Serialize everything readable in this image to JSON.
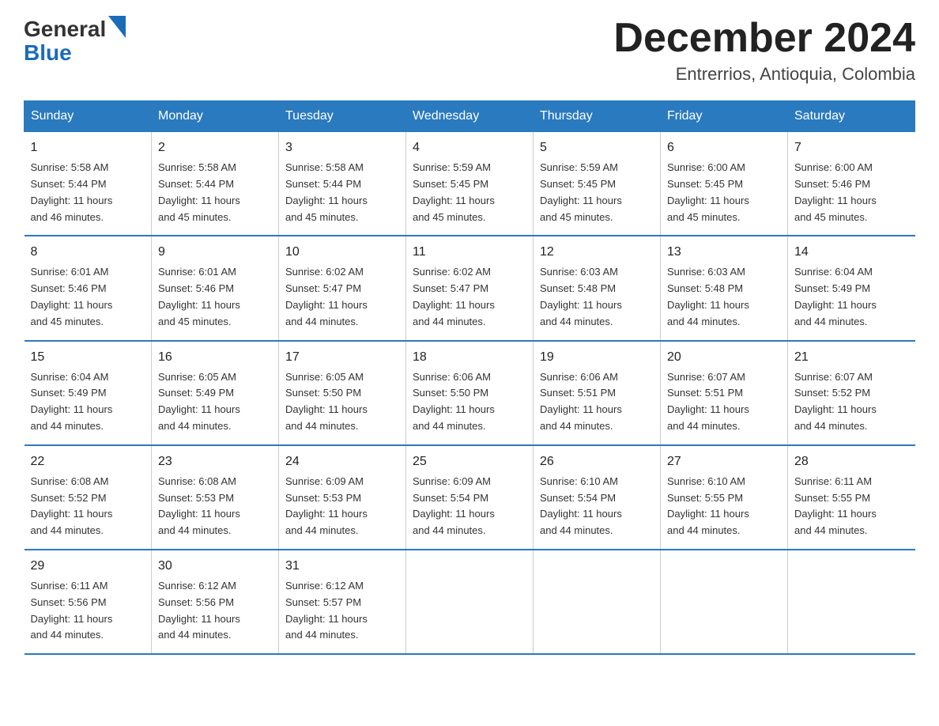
{
  "logo": {
    "general": "General",
    "blue": "Blue"
  },
  "header": {
    "month": "December 2024",
    "location": "Entrerrios, Antioquia, Colombia"
  },
  "weekdays": [
    "Sunday",
    "Monday",
    "Tuesday",
    "Wednesday",
    "Thursday",
    "Friday",
    "Saturday"
  ],
  "weeks": [
    [
      {
        "day": "1",
        "sunrise": "5:58 AM",
        "sunset": "5:44 PM",
        "daylight": "11 hours and 46 minutes."
      },
      {
        "day": "2",
        "sunrise": "5:58 AM",
        "sunset": "5:44 PM",
        "daylight": "11 hours and 45 minutes."
      },
      {
        "day": "3",
        "sunrise": "5:58 AM",
        "sunset": "5:44 PM",
        "daylight": "11 hours and 45 minutes."
      },
      {
        "day": "4",
        "sunrise": "5:59 AM",
        "sunset": "5:45 PM",
        "daylight": "11 hours and 45 minutes."
      },
      {
        "day": "5",
        "sunrise": "5:59 AM",
        "sunset": "5:45 PM",
        "daylight": "11 hours and 45 minutes."
      },
      {
        "day": "6",
        "sunrise": "6:00 AM",
        "sunset": "5:45 PM",
        "daylight": "11 hours and 45 minutes."
      },
      {
        "day": "7",
        "sunrise": "6:00 AM",
        "sunset": "5:46 PM",
        "daylight": "11 hours and 45 minutes."
      }
    ],
    [
      {
        "day": "8",
        "sunrise": "6:01 AM",
        "sunset": "5:46 PM",
        "daylight": "11 hours and 45 minutes."
      },
      {
        "day": "9",
        "sunrise": "6:01 AM",
        "sunset": "5:46 PM",
        "daylight": "11 hours and 45 minutes."
      },
      {
        "day": "10",
        "sunrise": "6:02 AM",
        "sunset": "5:47 PM",
        "daylight": "11 hours and 44 minutes."
      },
      {
        "day": "11",
        "sunrise": "6:02 AM",
        "sunset": "5:47 PM",
        "daylight": "11 hours and 44 minutes."
      },
      {
        "day": "12",
        "sunrise": "6:03 AM",
        "sunset": "5:48 PM",
        "daylight": "11 hours and 44 minutes."
      },
      {
        "day": "13",
        "sunrise": "6:03 AM",
        "sunset": "5:48 PM",
        "daylight": "11 hours and 44 minutes."
      },
      {
        "day": "14",
        "sunrise": "6:04 AM",
        "sunset": "5:49 PM",
        "daylight": "11 hours and 44 minutes."
      }
    ],
    [
      {
        "day": "15",
        "sunrise": "6:04 AM",
        "sunset": "5:49 PM",
        "daylight": "11 hours and 44 minutes."
      },
      {
        "day": "16",
        "sunrise": "6:05 AM",
        "sunset": "5:49 PM",
        "daylight": "11 hours and 44 minutes."
      },
      {
        "day": "17",
        "sunrise": "6:05 AM",
        "sunset": "5:50 PM",
        "daylight": "11 hours and 44 minutes."
      },
      {
        "day": "18",
        "sunrise": "6:06 AM",
        "sunset": "5:50 PM",
        "daylight": "11 hours and 44 minutes."
      },
      {
        "day": "19",
        "sunrise": "6:06 AM",
        "sunset": "5:51 PM",
        "daylight": "11 hours and 44 minutes."
      },
      {
        "day": "20",
        "sunrise": "6:07 AM",
        "sunset": "5:51 PM",
        "daylight": "11 hours and 44 minutes."
      },
      {
        "day": "21",
        "sunrise": "6:07 AM",
        "sunset": "5:52 PM",
        "daylight": "11 hours and 44 minutes."
      }
    ],
    [
      {
        "day": "22",
        "sunrise": "6:08 AM",
        "sunset": "5:52 PM",
        "daylight": "11 hours and 44 minutes."
      },
      {
        "day": "23",
        "sunrise": "6:08 AM",
        "sunset": "5:53 PM",
        "daylight": "11 hours and 44 minutes."
      },
      {
        "day": "24",
        "sunrise": "6:09 AM",
        "sunset": "5:53 PM",
        "daylight": "11 hours and 44 minutes."
      },
      {
        "day": "25",
        "sunrise": "6:09 AM",
        "sunset": "5:54 PM",
        "daylight": "11 hours and 44 minutes."
      },
      {
        "day": "26",
        "sunrise": "6:10 AM",
        "sunset": "5:54 PM",
        "daylight": "11 hours and 44 minutes."
      },
      {
        "day": "27",
        "sunrise": "6:10 AM",
        "sunset": "5:55 PM",
        "daylight": "11 hours and 44 minutes."
      },
      {
        "day": "28",
        "sunrise": "6:11 AM",
        "sunset": "5:55 PM",
        "daylight": "11 hours and 44 minutes."
      }
    ],
    [
      {
        "day": "29",
        "sunrise": "6:11 AM",
        "sunset": "5:56 PM",
        "daylight": "11 hours and 44 minutes."
      },
      {
        "day": "30",
        "sunrise": "6:12 AM",
        "sunset": "5:56 PM",
        "daylight": "11 hours and 44 minutes."
      },
      {
        "day": "31",
        "sunrise": "6:12 AM",
        "sunset": "5:57 PM",
        "daylight": "11 hours and 44 minutes."
      },
      null,
      null,
      null,
      null
    ]
  ],
  "labels": {
    "sunrise": "Sunrise:",
    "sunset": "Sunset:",
    "daylight": "Daylight:"
  }
}
